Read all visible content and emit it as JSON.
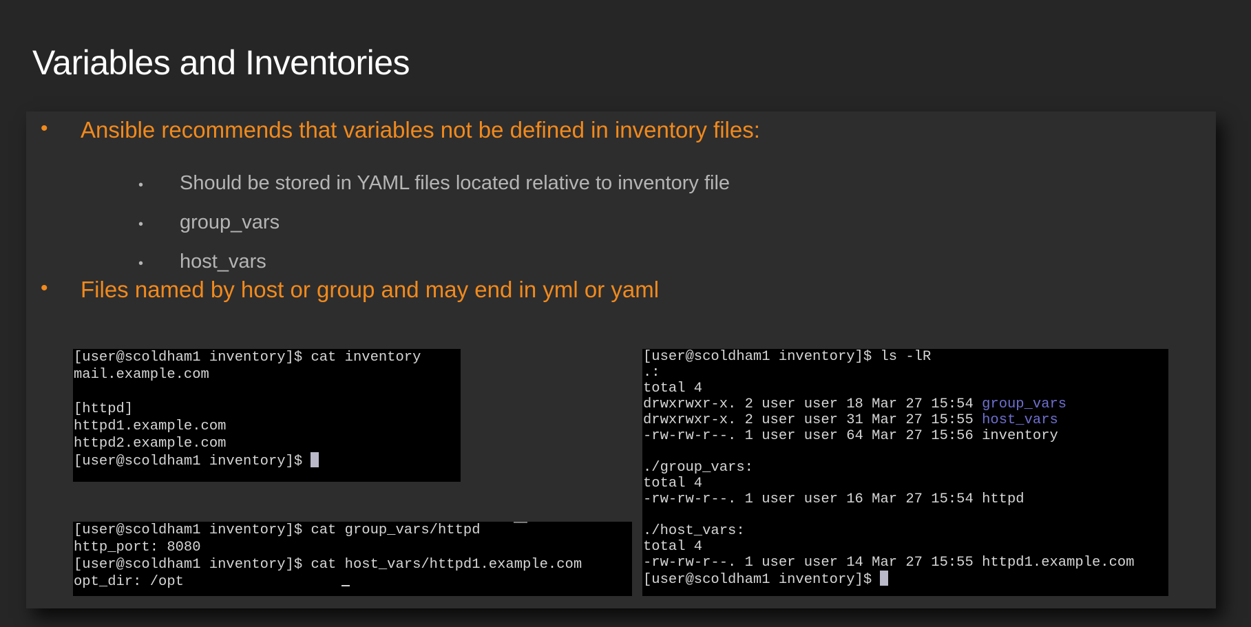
{
  "slide": {
    "title": "Variables and Inventories"
  },
  "bullets": {
    "b1": "Ansible recommends that variables not be defined in inventory files:",
    "b1_sub1": "Should be stored in YAML files located relative to inventory file",
    "b1_sub2": "group_vars",
    "b1_sub3": "host_vars",
    "b2": "Files named by host or group and may end in yml or yaml",
    "marker_l1": "•",
    "marker_l2": "•"
  },
  "terminal_inventory": {
    "lines": [
      "[user@scoldham1 inventory]$ cat inventory",
      "mail.example.com",
      "",
      "[httpd]",
      "httpd1.example.com",
      "httpd2.example.com",
      "[user@scoldham1 inventory]$ "
    ]
  },
  "terminal_vars": {
    "lines": [
      "[user@scoldham1 inventory]$ cat group_vars/httpd",
      "http_port: 8080",
      "[user@scoldham1 inventory]$ cat host_vars/httpd1.example.com",
      "opt_dir: /opt"
    ]
  },
  "terminal_ls": {
    "prompt_cmd": "[user@scoldham1 inventory]$ ls -lR",
    "dot_header": ".:",
    "total_1": "total 4",
    "row_group_vars_prefix": "drwxrwxr-x. 2 user user 18 Mar 27 15:54 ",
    "row_group_vars_name": "group_vars",
    "row_host_vars_prefix": "drwxrwxr-x. 2 user user 31 Mar 27 15:55 ",
    "row_host_vars_name": "host_vars",
    "row_inventory": "-rw-rw-r--. 1 user user 64 Mar 27 15:56 inventory",
    "group_vars_header": "./group_vars:",
    "total_2": "total 4",
    "row_httpd": "-rw-rw-r--. 1 user user 16 Mar 27 15:54 httpd",
    "host_vars_header": "./host_vars:",
    "total_3": "total 4",
    "row_httpd1": "-rw-rw-r--. 1 user user 14 Mar 27 15:55 httpd1.example.com",
    "final_prompt": "[user@scoldham1 inventory]$ "
  },
  "colors": {
    "background": "#262627",
    "panel": "#2d2d2e",
    "accent_orange": "#f28a1c",
    "sub_bullet_gray": "#b5b5b5",
    "directory_blue": "#6f6fd0",
    "terminal_bg": "#000000",
    "terminal_text": "#d6d6d6"
  }
}
